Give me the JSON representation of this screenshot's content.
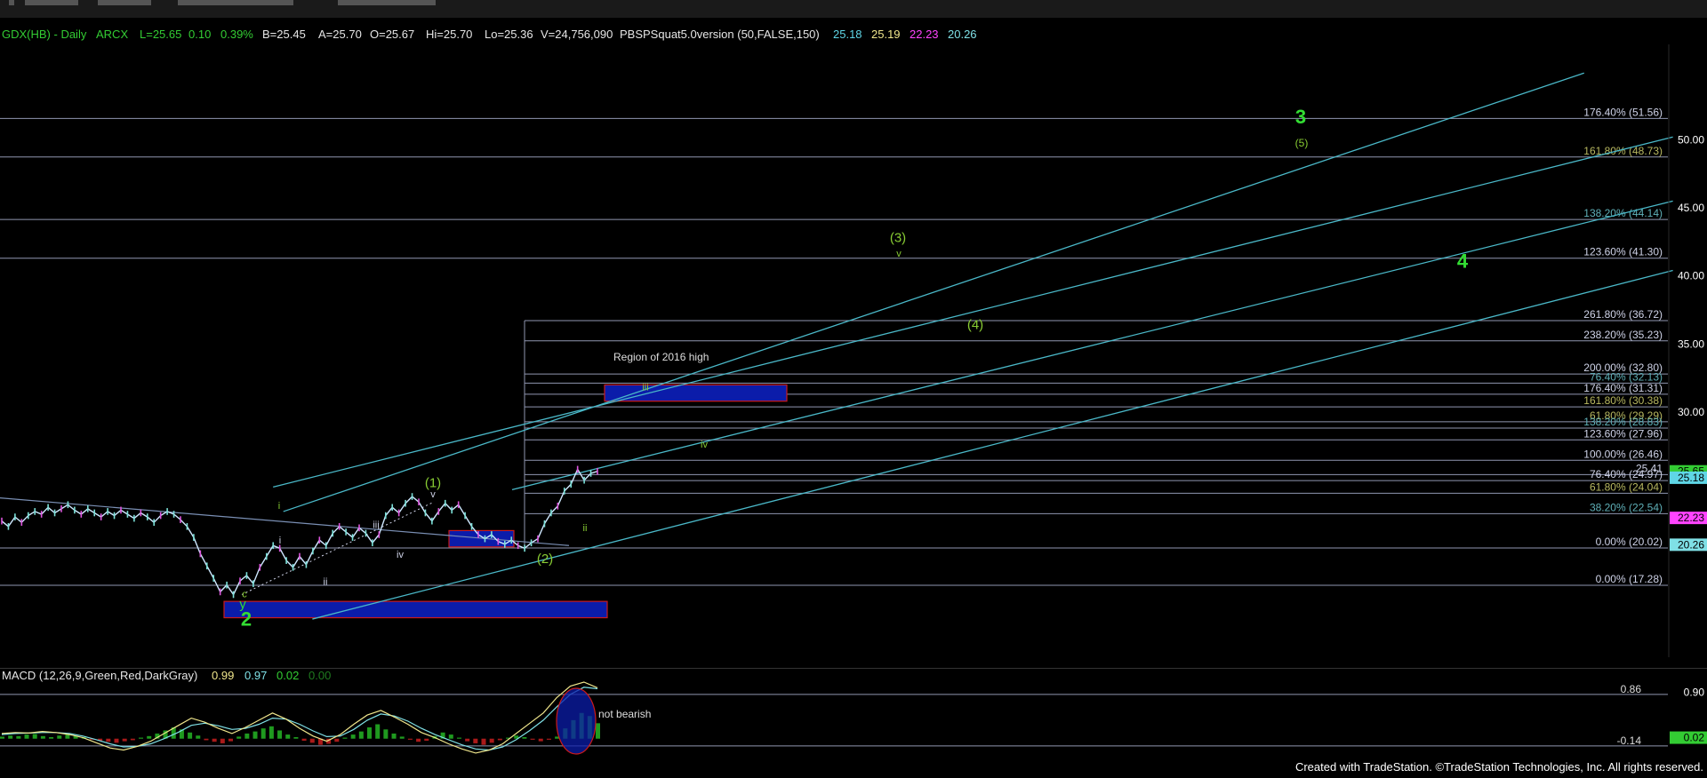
{
  "header": {
    "symbol": "GDX(HB) - Daily",
    "exchange": "ARCX",
    "last": "L=25.65",
    "change": "0.10",
    "change_pct": "0.39%",
    "bid": "B=25.45",
    "ask": "A=25.70",
    "open": "O=25.67",
    "high": "Hi=25.70",
    "low": "Lo=25.36",
    "volume": "V=24,756,090",
    "study": "PBSPSquat5.0version (50,FALSE,150)",
    "study_values": [
      {
        "text": "25.18",
        "color": "#5fd6e6"
      },
      {
        "text": "25.19",
        "color": "#f0e68c"
      },
      {
        "text": "22.23",
        "color": "#ff44ff"
      },
      {
        "text": "20.26",
        "color": "#7fe0e6"
      }
    ]
  },
  "colors": {
    "green_label": "#33dd33",
    "wave_label": "#88cc33",
    "fib_line": "#8f96b0",
    "channel": "#4ab8c8",
    "price_up": "#cfe8ff",
    "box_fill": "#0b1caa",
    "box_border": "#cc1a1a"
  },
  "annotations": {
    "region_2016": "Region of 2016 high",
    "not_bearish": "not bearish"
  },
  "chart_data": [
    {
      "type": "line",
      "title": "GDX(HB) - Daily",
      "ylim": [
        12,
        57
      ],
      "y_ticks": [
        "50.00",
        "45.00",
        "40.00",
        "35.00",
        "30.00"
      ],
      "last_price_labels": [
        {
          "text": "25.65",
          "value": 25.65,
          "bg": "#33cc33"
        },
        {
          "text": "25.18",
          "value": 25.18,
          "bg": "#5fd6e6"
        },
        {
          "text": "22.23",
          "value": 22.23,
          "bg": "#ff44ff"
        },
        {
          "text": "20.26",
          "value": 20.26,
          "bg": "#7fe0e6"
        }
      ],
      "fib_levels": [
        {
          "label": "176.40% (51.56)",
          "value": 51.56,
          "color": "#cfd3e8"
        },
        {
          "label": "161.80% (48.73)",
          "value": 48.73,
          "color": "#b8b860"
        },
        {
          "label": "138.20% (44.14)",
          "value": 44.14,
          "color": "#5fb0b8"
        },
        {
          "label": "123.60% (41.30)",
          "value": 41.3,
          "color": "#cfd3e8"
        },
        {
          "label": "261.80% (36.72)",
          "value": 36.72,
          "color": "#cfd3e8"
        },
        {
          "label": "238.20% (35.23)",
          "value": 35.23,
          "color": "#cfd3e8"
        },
        {
          "label": "200.00% (32.80)",
          "value": 32.8,
          "color": "#cfd3e8"
        },
        {
          "label": "76.40% (32.13)",
          "value": 32.13,
          "color": "#5fb0b8"
        },
        {
          "label": "176.40% (31.31)",
          "value": 31.31,
          "color": "#cfd3e8"
        },
        {
          "label": "161.80% (30.38)",
          "value": 30.38,
          "color": "#b8b860"
        },
        {
          "label": "61.80% (29.29)",
          "value": 29.29,
          "color": "#b8b860"
        },
        {
          "label": "138.20% (28.83)",
          "value": 28.83,
          "color": "#5fb0b8"
        },
        {
          "label": "123.60% (27.96)",
          "value": 27.96,
          "color": "#cfd3e8"
        },
        {
          "label": "100.00% (26.46)",
          "value": 26.46,
          "color": "#cfd3e8"
        },
        {
          "label": "25.41",
          "value": 25.41,
          "color": "#cfd3e8"
        },
        {
          "label": "76.40% (24.97)",
          "value": 24.97,
          "color": "#cfd3e8"
        },
        {
          "label": "61.80% (24.04)",
          "value": 24.04,
          "color": "#b8b860"
        },
        {
          "label": "38.20% (22.54)",
          "value": 22.54,
          "color": "#5fb0b8"
        },
        {
          "label": "0.00% (20.02)",
          "value": 20.02,
          "color": "#cfd3e8"
        },
        {
          "label": "0.00% (17.28)",
          "value": 17.28,
          "color": "#cfd3e8"
        }
      ],
      "wave_labels": [
        {
          "text": "3",
          "value": 51.2,
          "color": "#33dd33",
          "size": "large"
        },
        {
          "text": "(5)",
          "value": 49.5,
          "color": "#88cc33",
          "size": "small"
        },
        {
          "text": "(3)",
          "value": 42.5,
          "color": "#88cc33",
          "size": "medium"
        },
        {
          "text": "v",
          "value": 41.4,
          "color": "#88cc33",
          "size": "tiny"
        },
        {
          "text": "4",
          "value": 40.6,
          "color": "#33dd33",
          "size": "large"
        },
        {
          "text": "(4)",
          "value": 36.1,
          "color": "#88cc33",
          "size": "medium"
        },
        {
          "text": "iii",
          "value": 31.6,
          "color": "#88cc33",
          "size": "tiny"
        },
        {
          "text": "iv",
          "value": 27.4,
          "color": "#88cc33",
          "size": "tiny"
        },
        {
          "text": "(1)",
          "value": 24.5,
          "color": "#88cc33",
          "size": "medium"
        },
        {
          "text": "v",
          "value": 23.75,
          "color": "#cfd3e8",
          "size": "tiny"
        },
        {
          "text": "i",
          "value": 22.9,
          "color": "#88cc33",
          "size": "tiny"
        },
        {
          "text": "iii",
          "value": 21.5,
          "color": "#cfd3e8",
          "size": "tiny"
        },
        {
          "text": "ii",
          "value": 21.25,
          "color": "#88cc33",
          "size": "tiny"
        },
        {
          "text": "i",
          "value": 20.35,
          "color": "#cfd3e8",
          "size": "tiny"
        },
        {
          "text": "iv",
          "value": 19.3,
          "color": "#cfd3e8",
          "size": "tiny"
        },
        {
          "text": "(2)",
          "value": 18.9,
          "color": "#88cc33",
          "size": "medium"
        },
        {
          "text": "ii",
          "value": 17.3,
          "color": "#cfd3e8",
          "size": "tiny"
        },
        {
          "text": "c",
          "value": 16.4,
          "color": "#88cc33",
          "size": "tiny"
        },
        {
          "text": "y",
          "value": 15.6,
          "color": "#33dd33",
          "size": "medium"
        },
        {
          "text": "2",
          "value": 14.3,
          "color": "#33dd33",
          "size": "large"
        }
      ],
      "boxes": [
        {
          "label": "iii",
          "y_top": 32.0,
          "y_bottom": 30.8
        },
        {
          "label": "",
          "y_top": 16.1,
          "y_bottom": 14.9
        },
        {
          "label": "",
          "y_top": 21.3,
          "y_bottom": 20.1
        }
      ],
      "price": [
        22.0,
        21.6,
        22.3,
        21.9,
        22.4,
        22.7,
        22.5,
        23.0,
        22.6,
        22.9,
        23.2,
        22.8,
        22.5,
        22.9,
        22.6,
        22.3,
        22.7,
        22.4,
        22.8,
        22.5,
        22.2,
        22.6,
        22.3,
        21.9,
        22.4,
        22.7,
        22.5,
        22.1,
        21.6,
        20.8,
        19.6,
        18.7,
        17.8,
        16.8,
        17.3,
        16.6,
        17.6,
        18.0,
        17.4,
        18.6,
        19.4,
        20.2,
        20.0,
        19.1,
        18.6,
        19.4,
        18.8,
        19.8,
        20.6,
        20.2,
        21.1,
        21.6,
        21.2,
        20.8,
        21.5,
        21.1,
        20.4,
        21.0,
        22.4,
        23.0,
        22.6,
        23.3,
        23.8,
        23.4,
        22.6,
        22.0,
        22.7,
        23.3,
        22.8,
        23.2,
        22.4,
        21.6,
        21.0,
        20.7,
        21.0,
        20.5,
        20.3,
        20.6,
        20.2,
        20.0,
        20.4,
        20.7,
        21.8,
        22.6,
        23.1,
        24.2,
        24.7,
        25.8,
        25.0,
        25.5,
        25.65
      ],
      "channels": [
        {
          "x0": 0.166,
          "y0": 22.7,
          "x1": 0.928,
          "y1": 54.9
        },
        {
          "x0": 0.16,
          "y0": 24.5,
          "x1": 0.98,
          "y1": 50.2
        },
        {
          "x0": 0.183,
          "y0": 14.8,
          "x1": 0.98,
          "y1": 40.4
        },
        {
          "x0": 0.3,
          "y0": 24.3,
          "x1": 0.98,
          "y1": 45.5
        }
      ]
    },
    {
      "type": "bar",
      "title": "MACD (12,26,9,Green,Red,DarkGray)",
      "legend": [
        {
          "text": "0.99",
          "color": "#f0e68c"
        },
        {
          "text": "0.97",
          "color": "#7fe0e6"
        },
        {
          "text": "0.02",
          "color": "#33cc33"
        },
        {
          "text": "0.00",
          "color": "#1f7a1f"
        }
      ],
      "y_ticks": [
        "0.90"
      ],
      "levels": [
        {
          "text": "0.86",
          "value": 0.86
        },
        {
          "text": "-0.14",
          "value": -0.14
        }
      ],
      "last_label": {
        "text": "0.02",
        "bg": "#33cc33"
      },
      "ylim": [
        -0.35,
        1.1
      ],
      "histogram": [
        0.04,
        0.06,
        0.05,
        0.08,
        0.09,
        0.05,
        0.03,
        0.06,
        0.08,
        0.05,
        0.03,
        -0.02,
        -0.04,
        -0.06,
        -0.08,
        -0.05,
        -0.03,
        0.02,
        0.05,
        0.1,
        0.16,
        0.22,
        0.18,
        0.12,
        0.06,
        -0.03,
        -0.06,
        -0.09,
        -0.05,
        0.04,
        0.1,
        0.14,
        0.2,
        0.24,
        0.16,
        0.08,
        0.03,
        -0.04,
        -0.08,
        -0.12,
        -0.1,
        -0.06,
        0.02,
        0.08,
        0.14,
        0.22,
        0.28,
        0.18,
        0.1,
        0.04,
        -0.02,
        -0.06,
        -0.04,
        0.05,
        0.12,
        0.08,
        0.02,
        -0.05,
        -0.09,
        -0.12,
        -0.08,
        -0.03,
        0.02,
        0.06,
        0.03,
        -0.02,
        -0.05,
        -0.02,
        0.04,
        0.2,
        0.36,
        0.5,
        0.44,
        0.3
      ],
      "macd_line": [
        0.1,
        0.12,
        0.11,
        0.14,
        0.12,
        0.08,
        0.02,
        -0.08,
        -0.18,
        -0.22,
        -0.15,
        -0.05,
        0.1,
        0.25,
        0.4,
        0.32,
        0.2,
        0.1,
        0.22,
        0.36,
        0.5,
        0.38,
        0.2,
        0.05,
        -0.05,
        0.08,
        0.28,
        0.46,
        0.55,
        0.42,
        0.28,
        0.12,
        0.02,
        -0.1,
        -0.2,
        -0.28,
        -0.22,
        -0.1,
        0.1,
        0.3,
        0.5,
        0.8,
        1.02,
        1.1,
        0.99
      ],
      "signal_line": [
        0.08,
        0.1,
        0.11,
        0.12,
        0.12,
        0.1,
        0.05,
        -0.02,
        -0.1,
        -0.16,
        -0.15,
        -0.1,
        0.0,
        0.12,
        0.26,
        0.3,
        0.25,
        0.18,
        0.2,
        0.28,
        0.4,
        0.38,
        0.28,
        0.15,
        0.04,
        0.05,
        0.18,
        0.36,
        0.48,
        0.44,
        0.34,
        0.2,
        0.08,
        -0.02,
        -0.12,
        -0.2,
        -0.22,
        -0.16,
        -0.02,
        0.16,
        0.36,
        0.62,
        0.86,
        1.0,
        0.97
      ]
    }
  ],
  "footer": "Created with TradeStation. ©TradeStation Technologies, Inc. All rights reserved."
}
